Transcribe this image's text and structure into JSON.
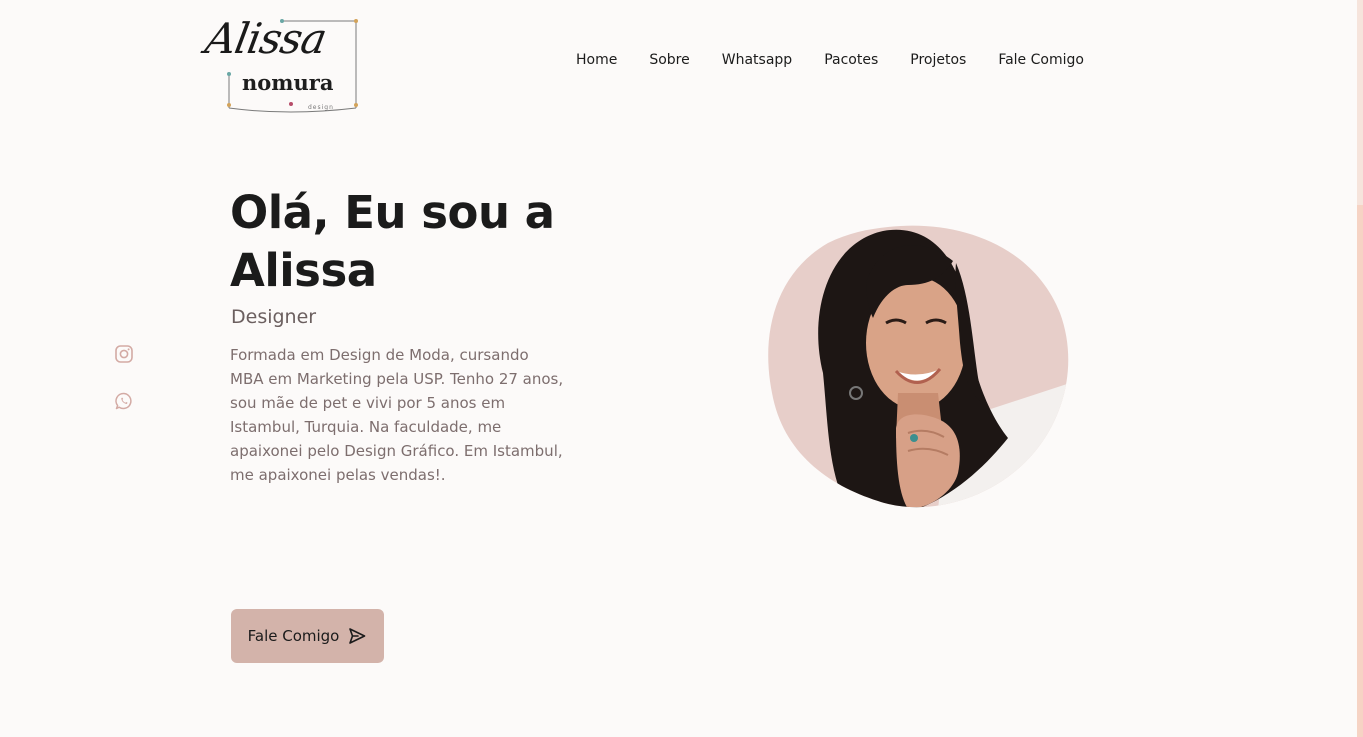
{
  "brand": {
    "script": "Alissa",
    "word": "nomura",
    "sub": "design"
  },
  "nav": {
    "items": [
      {
        "label": "Home"
      },
      {
        "label": "Sobre"
      },
      {
        "label": "Whatsapp"
      },
      {
        "label": "Pacotes"
      },
      {
        "label": "Projetos"
      },
      {
        "label": "Fale Comigo"
      }
    ]
  },
  "social": {
    "icons": [
      "instagram-icon",
      "whatsapp-icon"
    ],
    "color": "#d3aaa4"
  },
  "hero": {
    "title": "Olá, Eu sou a Alissa",
    "subtitle": "Designer",
    "description": "Formada em Design de Moda, cursando MBA em Marketing pela USP. Tenho 27 anos, sou mãe de pet e vivi por 5 anos em Istambul, Turquia. Na faculdade, me apaixonei pelo Design Gráfico. Em Istambul, me apaixonei pelas vendas!.",
    "cta_label": "Fale Comigo",
    "cta_icon": "send-icon"
  },
  "colors": {
    "background": "#fcfaf9",
    "accent": "#d3b3aa",
    "blob": "#e7cec9",
    "text": "#1b1b1b",
    "muted": "#7d6e6e"
  }
}
